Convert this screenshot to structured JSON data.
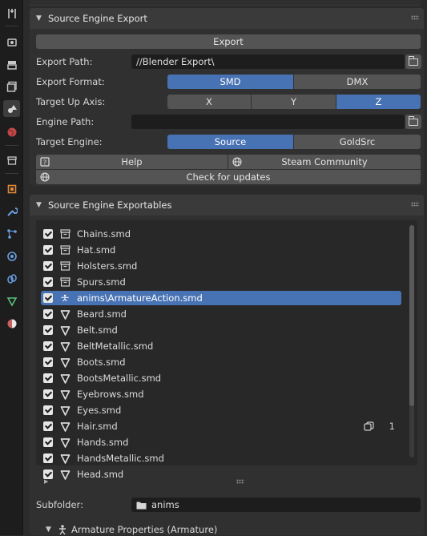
{
  "sidebar": {
    "icons": [
      "tool-icon",
      "render-icon",
      "output-icon",
      "view-layer-icon",
      "scene-icon",
      "world-icon",
      "collection-icon",
      "object-icon",
      "modifier-icon",
      "particles-icon",
      "physics-icon",
      "constraints-icon",
      "data-icon",
      "texture-icon"
    ]
  },
  "export_panel": {
    "title": "Source Engine Export",
    "export_button": "Export",
    "export_path_label": "Export Path:",
    "export_path_value": "//Blender Export\\",
    "export_format_label": "Export Format:",
    "formats": [
      "SMD",
      "DMX"
    ],
    "selected_format": "SMD",
    "up_axis_label": "Target Up Axis:",
    "axes": [
      "X",
      "Y",
      "Z"
    ],
    "selected_axis": "Z",
    "engine_path_label": "Engine Path:",
    "engine_path_value": "",
    "target_engine_label": "Target Engine:",
    "engines": [
      "Source",
      "GoldSrc"
    ],
    "selected_engine": "Source",
    "help_label": "Help",
    "steam_label": "Steam Community",
    "updates_label": "Check for updates"
  },
  "exportables_panel": {
    "title": "Source Engine Exportables",
    "items": [
      {
        "name": "Chains.smd",
        "type": "collection"
      },
      {
        "name": "Hat.smd",
        "type": "collection"
      },
      {
        "name": "Holsters.smd",
        "type": "collection"
      },
      {
        "name": "Spurs.smd",
        "type": "collection"
      },
      {
        "name": "anims\\ArmatureAction.smd",
        "type": "armature",
        "selected": true
      },
      {
        "name": "Beard.smd",
        "type": "mesh"
      },
      {
        "name": "Belt.smd",
        "type": "mesh"
      },
      {
        "name": "BeltMetallic.smd",
        "type": "mesh"
      },
      {
        "name": "Boots.smd",
        "type": "mesh"
      },
      {
        "name": "BootsMetallic.smd",
        "type": "mesh"
      },
      {
        "name": "Eyebrows.smd",
        "type": "mesh"
      },
      {
        "name": "Eyes.smd",
        "type": "mesh"
      },
      {
        "name": "Hair.smd",
        "type": "mesh",
        "count": "1"
      },
      {
        "name": "Hands.smd",
        "type": "mesh"
      },
      {
        "name": "HandsMetallic.smd",
        "type": "mesh"
      },
      {
        "name": "Head.smd",
        "type": "mesh"
      }
    ],
    "subfolder_label": "Subfolder:",
    "subfolder_value": "anims",
    "sub_panel_title": "Armature Properties (Armature)"
  },
  "colors": {
    "accent": "#4772b3",
    "panel": "#303030",
    "background": "#2b2b2b"
  }
}
